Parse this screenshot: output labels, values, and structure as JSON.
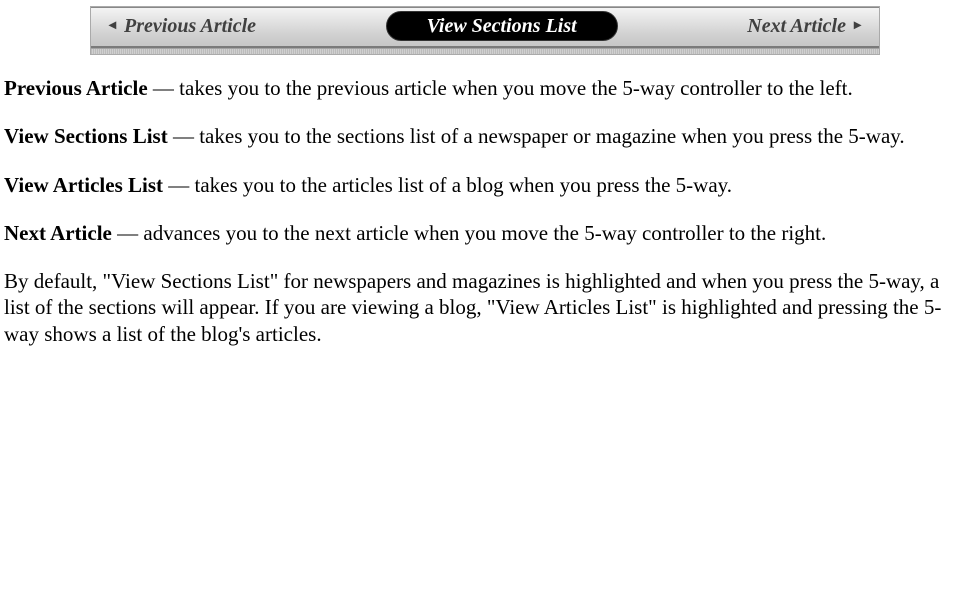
{
  "toolbar": {
    "prev_arrow": "◂",
    "prev_label": "Previous Article",
    "center_label": "View Sections List",
    "next_label": "Next Article",
    "next_arrow": "▸"
  },
  "defs": [
    {
      "term": "Previous Article",
      "dash": " — ",
      "desc": "takes you to the previous article when you move the 5-way controller to the left."
    },
    {
      "term": "View Sections List",
      "dash": " — ",
      "desc": "takes you to the sections list of a newspaper or magazine when you press the 5-way."
    },
    {
      "term": "View Articles List",
      "dash": " — ",
      "desc": "takes you to the articles list of a blog when you press the 5-way."
    },
    {
      "term": "Next Article",
      "dash": " — ",
      "desc": "advances you to the next article when you move the 5-way controller to the right."
    }
  ],
  "footer_para": "By default, \"View Sections List\" for newspapers and magazines is highlighted and when you press the 5-way, a list of the sections will appear. If you are viewing a blog, \"View Articles List\" is highlighted and pressing the 5-way shows a list of the blog's articles."
}
